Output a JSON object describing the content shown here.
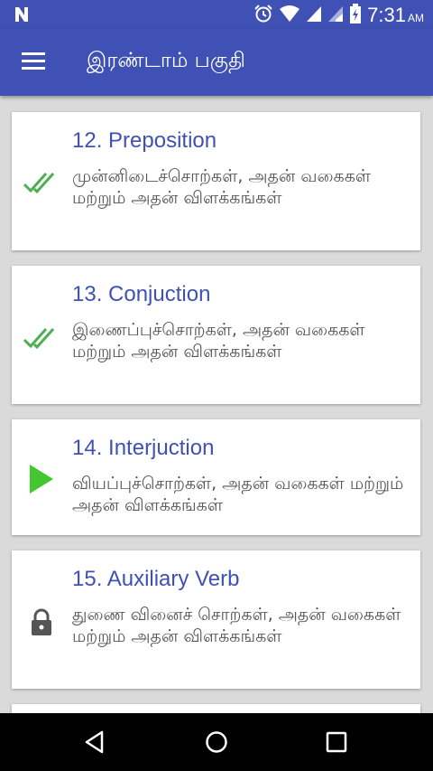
{
  "status_bar": {
    "time": "7:31",
    "ampm": "AM",
    "icons": [
      "notification-n-icon",
      "alarm-icon",
      "wifi-icon",
      "signal-icon",
      "signal-icon",
      "battery-icon"
    ]
  },
  "app_bar": {
    "title": "இரண்டாம் பகுதி",
    "menu_icon": "hamburger-menu-icon"
  },
  "lessons": [
    {
      "title": "12. Preposition",
      "description": "முன்னிடைச்சொற்கள், அதன் வகைகள் மற்றும் அதன் விளக்கங்கள்",
      "status": "completed",
      "icon": "double-check-icon"
    },
    {
      "title": "13. Conjuction",
      "description": "இணைப்புச்சொற்கள், அதன் வகைகள் மற்றும் அதன் விளக்கங்கள்",
      "status": "completed",
      "icon": "double-check-icon"
    },
    {
      "title": "14. Interjuction",
      "description": "வியப்புச்சொற்கள், அதன் வகைகள் மற்றும் அதன் விளக்கங்கள்",
      "status": "current",
      "icon": "play-icon"
    },
    {
      "title": "15. Auxiliary Verb",
      "description": "துணை வினைச் சொற்கள், அதன் வகைகள் மற்றும் அதன் விளக்கங்கள்",
      "status": "locked",
      "icon": "lock-icon"
    }
  ],
  "colors": {
    "primary": "#3f51b5",
    "check": "#4caf50",
    "play": "#43c630",
    "lock": "#555555"
  },
  "nav_bar": {
    "buttons": [
      "back-icon",
      "home-icon",
      "recents-icon"
    ]
  }
}
